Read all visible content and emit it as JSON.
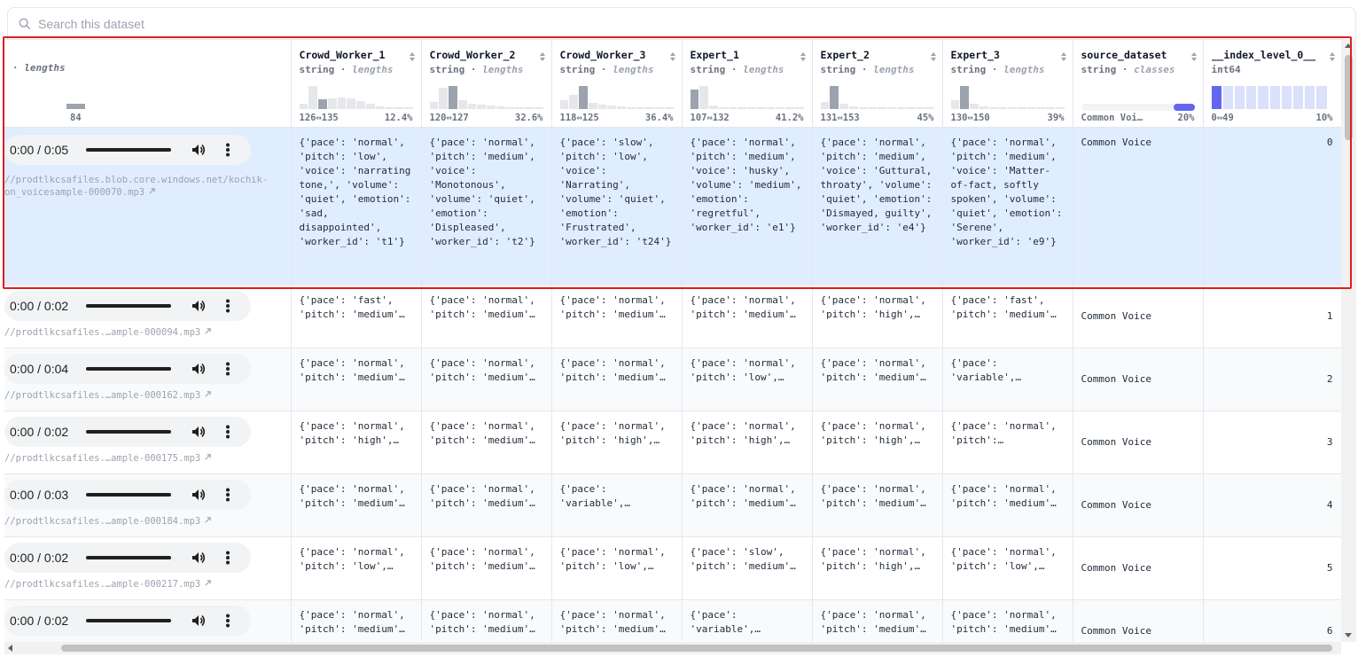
{
  "search": {
    "placeholder": "Search this dataset",
    "icon": "search-icon"
  },
  "columns": [
    {
      "name": "",
      "type": "· lengths",
      "range_min": "",
      "range_max": "84",
      "bars": [
        0,
        0,
        0,
        0,
        0,
        0,
        0,
        0,
        0,
        0,
        0,
        0,
        0,
        0,
        0,
        0,
        0,
        0,
        0,
        0,
        0,
        0,
        0,
        0,
        0,
        0,
        0,
        0,
        0,
        0,
        0,
        0,
        0,
        0,
        0,
        0,
        0,
        0,
        0,
        0,
        0,
        0,
        0,
        0,
        0,
        0,
        0,
        0,
        0,
        0,
        0,
        0,
        0,
        0,
        0,
        0,
        0,
        0,
        0,
        0,
        0,
        0,
        0,
        0,
        0,
        0,
        0,
        0,
        0,
        6,
        0
      ]
    },
    {
      "name": "Crowd_Worker_1",
      "type": "string",
      "type2": "lengths",
      "range_min": "126⇔135",
      "range_max": "12.4%",
      "bars": [
        6,
        28,
        12,
        13,
        14,
        13,
        10,
        6,
        3,
        2,
        1,
        1
      ],
      "hl": 2
    },
    {
      "name": "Crowd_Worker_2",
      "type": "string",
      "type2": "lengths",
      "range_min": "120⇔127",
      "range_max": "32.6%",
      "bars": [
        8,
        24,
        26,
        10,
        6,
        5,
        4,
        3,
        2,
        2,
        1,
        1
      ],
      "hl": 2
    },
    {
      "name": "Crowd_Worker_3",
      "type": "string",
      "type2": "lengths",
      "range_min": "118⇔125",
      "range_max": "36.4%",
      "bars": [
        10,
        16,
        26,
        7,
        5,
        4,
        3,
        2,
        2,
        1,
        1,
        1
      ],
      "hl": 2
    },
    {
      "name": "Expert_1",
      "type": "string",
      "type2": "lengths",
      "range_min": "107⇔132",
      "range_max": "41.2%",
      "bars": [
        22,
        26,
        4,
        2,
        1,
        1,
        1,
        1,
        0,
        0,
        0,
        0
      ],
      "hl": 0
    },
    {
      "name": "Expert_2",
      "type": "string",
      "type2": "lengths",
      "range_min": "131⇔153",
      "range_max": "45%",
      "bars": [
        8,
        26,
        6,
        3,
        2,
        1,
        1,
        1,
        0,
        0,
        0,
        0
      ],
      "hl": 1
    },
    {
      "name": "Expert_3",
      "type": "string",
      "type2": "lengths",
      "range_min": "130⇔150",
      "range_max": "39%",
      "bars": [
        10,
        26,
        6,
        3,
        2,
        1,
        1,
        1,
        0,
        0,
        0,
        0
      ],
      "hl": 1
    },
    {
      "name": "source_dataset",
      "type": "string",
      "type2": "classes",
      "range_min": "Common Voi…",
      "range_max": "20%",
      "class_fraction": 0.2
    },
    {
      "name": "__index_level_0__",
      "type": "int64",
      "type2": "",
      "range_min": "0⇔49",
      "range_max": "10%",
      "bars": [
        1,
        1,
        1,
        1,
        1,
        1,
        1,
        1,
        1,
        1
      ],
      "hl": 0
    }
  ],
  "rows": [
    {
      "time": "0:00 / 0:05",
      "url": "//prodtlkcsafiles.blob.core.windows.net/kochik-on_voicesample-000070.mp3",
      "cw1": "{'pace': 'normal', 'pitch': 'low', 'voice': 'narrating tone,', 'volume': 'quiet', 'emotion': 'sad, disappointed', 'worker_id': 't1'}",
      "cw2": "{'pace': 'normal', 'pitch': 'medium', 'voice': 'Monotonous', 'volume': 'quiet', 'emotion': 'Displeased', 'worker_id': 't2'}",
      "cw3": "{'pace': 'slow', 'pitch': 'low', 'voice': 'Narrating', 'volume': 'quiet', 'emotion': 'Frustrated', 'worker_id': 't24'}",
      "e1": "{'pace': 'normal', 'pitch': 'medium', 'voice': 'husky', 'volume': 'medium', 'emotion': 'regretful', 'worker_id': 'e1'}",
      "e2": "{'pace': 'normal', 'pitch': 'medium', 'voice': 'Guttural, throaty', 'volume': 'quiet', 'emotion': 'Dismayed, guilty', 'worker_id': 'e4'}",
      "e3": "{'pace': 'normal', 'pitch': 'medium', 'voice': 'Matter-of-fact, softly spoken', 'volume': 'quiet', 'emotion': 'Serene', 'worker_id': 'e9'}",
      "src": "Common Voice",
      "idx": "0"
    },
    {
      "time": "0:00 / 0:02",
      "url": "//prodtlkcsafiles.…ample-000094.mp3",
      "cw1": "{'pace': 'fast', 'pitch': 'medium'…",
      "cw2": "{'pace': 'normal', 'pitch': 'medium'…",
      "cw3": "{'pace': 'normal', 'pitch': 'medium'…",
      "e1": "{'pace': 'normal', 'pitch': 'medium'…",
      "e2": "{'pace': 'normal', 'pitch': 'high',…",
      "e3": "{'pace': 'fast', 'pitch': 'medium'…",
      "src": "Common Voice",
      "idx": "1"
    },
    {
      "time": "0:00 / 0:04",
      "url": "//prodtlkcsafiles.…ample-000162.mp3",
      "cw1": "{'pace': 'normal', 'pitch': 'medium'…",
      "cw2": "{'pace': 'normal', 'pitch': 'medium'…",
      "cw3": "{'pace': 'normal', 'pitch': 'medium'…",
      "e1": "{'pace': 'normal', 'pitch': 'low',…",
      "e2": "{'pace': 'normal', 'pitch': 'medium'…",
      "e3": "{'pace': 'variable',…",
      "src": "Common Voice",
      "idx": "2"
    },
    {
      "time": "0:00 / 0:02",
      "url": "//prodtlkcsafiles.…ample-000175.mp3",
      "cw1": "{'pace': 'normal', 'pitch': 'high',…",
      "cw2": "{'pace': 'normal', 'pitch': 'medium'…",
      "cw3": "{'pace': 'normal', 'pitch': 'high',…",
      "e1": "{'pace': 'normal', 'pitch': 'high',…",
      "e2": "{'pace': 'normal', 'pitch': 'high',…",
      "e3": "{'pace': 'normal', 'pitch':…",
      "src": "Common Voice",
      "idx": "3"
    },
    {
      "time": "0:00 / 0:03",
      "url": "//prodtlkcsafiles.…ample-000184.mp3",
      "cw1": "{'pace': 'normal', 'pitch': 'medium'…",
      "cw2": "{'pace': 'normal', 'pitch': 'medium'…",
      "cw3": "{'pace': 'variable',…",
      "e1": "{'pace': 'normal', 'pitch': 'medium'…",
      "e2": "{'pace': 'normal', 'pitch': 'medium'…",
      "e3": "{'pace': 'normal', 'pitch': 'medium'…",
      "src": "Common Voice",
      "idx": "4"
    },
    {
      "time": "0:00 / 0:02",
      "url": "//prodtlkcsafiles.…ample-000217.mp3",
      "cw1": "{'pace': 'normal', 'pitch': 'low',…",
      "cw2": "{'pace': 'normal', 'pitch': 'medium'…",
      "cw3": "{'pace': 'normal', 'pitch': 'low',…",
      "e1": "{'pace': 'slow', 'pitch': 'medium'…",
      "e2": "{'pace': 'normal', 'pitch': 'high',…",
      "e3": "{'pace': 'normal', 'pitch': 'low',…",
      "src": "Common Voice",
      "idx": "5"
    },
    {
      "time": "0:00 / 0:02",
      "url": "//prodtlkcsafiles.…ample-000230.mp3",
      "cw1": "{'pace': 'normal', 'pitch': 'medium'…",
      "cw2": "{'pace': 'normal', 'pitch': 'medium'…",
      "cw3": "{'pace': 'normal', 'pitch': 'medium'…",
      "e1": "{'pace': 'variable',…",
      "e2": "{'pace': 'normal', 'pitch': 'medium'…",
      "e3": "{'pace': 'normal', 'pitch': 'medium'…",
      "src": "Common Voice",
      "idx": "6"
    }
  ],
  "colors": {
    "accent": "#6366f1",
    "selected_row": "#e0edff",
    "highlight_border": "#e11d1d"
  }
}
